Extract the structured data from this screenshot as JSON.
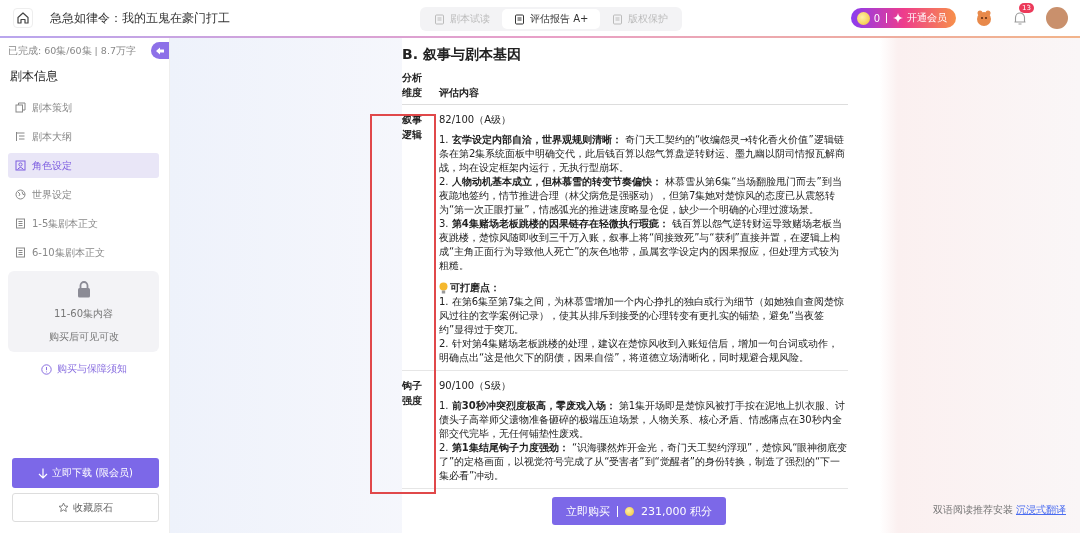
{
  "header": {
    "title": "急急如律令：我的五鬼在豪门打工",
    "tabs": [
      {
        "label": "剧本试读",
        "selected": false
      },
      {
        "label": "评估报告 A+",
        "selected": true
      },
      {
        "label": "版权保护",
        "selected": false
      }
    ],
    "points": "0",
    "vip_button": "开通会员",
    "notification_count": "13"
  },
  "sidebar": {
    "progress": "已完成: 60集/60集 | 8.7万字",
    "heading": "剧本信息",
    "items": [
      {
        "label": "剧本策划",
        "selected": false
      },
      {
        "label": "剧本大纲",
        "selected": false
      },
      {
        "label": "角色设定",
        "selected": true
      },
      {
        "label": "世界设定",
        "selected": false
      },
      {
        "label": "1-5集剧本正文",
        "selected": false
      },
      {
        "label": "6-10集剧本正文",
        "selected": false
      }
    ],
    "locked": {
      "title": "11-60集内容",
      "note": "购买后可见可改"
    },
    "notice_link": "购买与保障须知",
    "download_button": "立即下载 (限会员)",
    "collect_button": "收藏原石"
  },
  "report": {
    "title": "B. 叙事与剧本基因",
    "columns": [
      "分析维度",
      "评估内容"
    ],
    "rows": [
      {
        "dimension": "叙事逻辑",
        "score": "82/100（A级）",
        "points": [
          "1. **玄学设定内部自洽，世界观规则清晰：** 奇门天工契约的“收编怨灵→转化香火价值”逻辑链条在第2集系统面板中明确交代，此后钱百算以怨气算盘逆转财运、墨九幽以阴司情报瓦解商战，均在设定框架内运行，无执行型崩坏。",
          "2. **人物动机基本成立，但林慕雪的转变节奏偏快：** 林慕雪从第6集“当场翻脸甩门而去”到当夜跪地签约，情节推进合理（林父病危是强驱动），但第7集她对楚惊风的态度已从震怒转为“第一次正眼打量”，情感弧光的推进速度略显仓促，缺少一个明确的心理过渡场景。",
          "3. **第4集赌场老板跳楼的因果链存在轻微执行瑕疵：** 钱百算以怨气逆转财运导致赌场老板当夜跳楼，楚惊风随即收到三千万入账，叙事上将“间接致死”与“获利”直接并置，在逻辑上构成“主角正面行为导致他人死亡”的灰色地带，虽属玄学设定内的因果报应，但处理方式较为粗糙。"
        ],
        "tips_title": "可打磨点：",
        "tips": [
          "1. 在第6集至第7集之间，为林慕雪增加一个内心挣扎的独白或行为细节（如她独自查阅楚惊风过往的玄学案例记录），使其从排斥到接受的心理转变有更扎实的铺垫，避免“当夜签约”显得过于突兀。",
          "2. 针对第4集赌场老板跳楼的处理，建议在楚惊风收到入账短信后，增加一句台词或动作，明确点出“这是他欠下的阴债，因果自偿”，将道德立场清晰化，同时规避合规风险。"
        ]
      },
      {
        "dimension": "钩子强度",
        "score": "90/100（S级）",
        "points": [
          "1. **前30秒冲突烈度极高，零废戏入场：** 第1集开场即是楚惊风被打手按在泥地上扒衣服、讨债头子高举师父遗物准备砸碎的极端压迫场景，人物关系、核心矛盾、情感痛点在30秒内全部交代完毕，无任何铺垫性废戏。",
          "2. **第1集结尾钩子力度强劲：** “识海骤然炸开金光，奇门天工契约浮现”，楚惊风“眼神彻底变了”的定格画面，以视觉符号完成了从“受害者”到“觉醒者”的身份转换，制造了强烈的“下一集必看”冲动。"
        ]
      }
    ]
  },
  "buy_button": {
    "label": "立即购买",
    "price": "231,000 积分"
  },
  "footer_note": {
    "text": "双语阅读推荐安装",
    "link": "沉浸式翻译"
  }
}
